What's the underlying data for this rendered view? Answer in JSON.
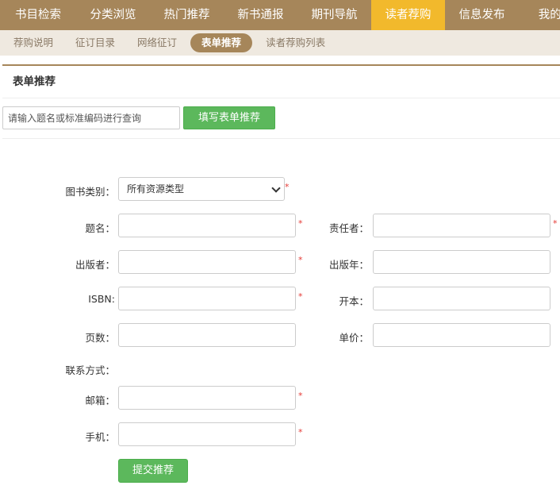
{
  "topnav": {
    "items": [
      {
        "label": "书目检索",
        "active": false
      },
      {
        "label": "分类浏览",
        "active": false
      },
      {
        "label": "热门推荐",
        "active": false
      },
      {
        "label": "新书通报",
        "active": false
      },
      {
        "label": "期刊导航",
        "active": false
      },
      {
        "label": "读者荐购",
        "active": true
      },
      {
        "label": "信息发布",
        "active": false
      },
      {
        "label": "我的图",
        "active": false
      }
    ]
  },
  "subnav": {
    "items": [
      {
        "label": "荐购说明",
        "active": false
      },
      {
        "label": "征订目录",
        "active": false
      },
      {
        "label": "网络征订",
        "active": false
      },
      {
        "label": "表单推荐",
        "active": true
      },
      {
        "label": "读者荐购列表",
        "active": false
      }
    ]
  },
  "panel": {
    "title": "表单推荐",
    "search_placeholder": "请输入题名或标准编码进行查询",
    "fill_button": "填写表单推荐"
  },
  "form": {
    "category_label": "图书类别：",
    "category_value": "所有资源类型",
    "title_label": "题名：",
    "author_label": "责任者：",
    "publisher_label": "出版者：",
    "pubyear_label": "出版年：",
    "isbn_label": "ISBN:",
    "format_label": "开本：",
    "pages_label": "页数：",
    "price_label": "单价：",
    "contact_label": "联系方式：",
    "email_label": "邮箱：",
    "phone_label": "手机：",
    "required_mark": "*",
    "submit_label": "提交推荐"
  },
  "colors": {
    "nav_bg": "#a6865a",
    "nav_active": "#f2b92c",
    "subnav_bg": "#efe9e0",
    "button_green": "#5cb85c",
    "required_red": "#e53935"
  }
}
